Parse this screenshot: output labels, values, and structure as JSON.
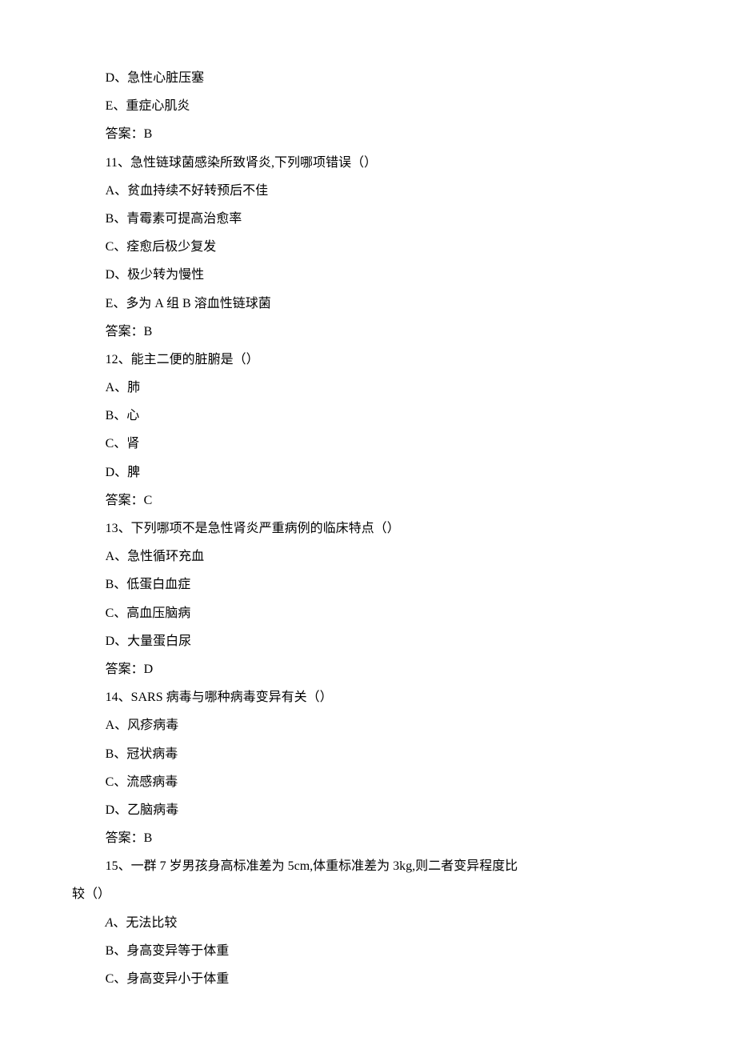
{
  "lines": [
    {
      "text": "D、急性心脏压塞",
      "indent": true
    },
    {
      "text": "E、重症心肌炎",
      "indent": true
    },
    {
      "text": "答案：B",
      "indent": true
    },
    {
      "text": "11、急性链球菌感染所致肾炎,下列哪项错误（）",
      "indent": true
    },
    {
      "text": "A、贫血持续不好转预后不佳",
      "indent": true
    },
    {
      "text": "B、青霉素可提高治愈率",
      "indent": true
    },
    {
      "text": "C、痊愈后极少复发",
      "indent": true
    },
    {
      "text": "D、极少转为慢性",
      "indent": true
    },
    {
      "text": "E、多为 A 组 B 溶血性链球菌",
      "indent": true
    },
    {
      "text": "答案：B",
      "indent": true
    },
    {
      "text": "12、能主二便的脏腑是（）",
      "indent": true
    },
    {
      "text": "A、肺",
      "indent": true
    },
    {
      "text": "B、心",
      "indent": true
    },
    {
      "text": "C、肾",
      "indent": true
    },
    {
      "text": "D、脾",
      "indent": true
    },
    {
      "text": "答案：C",
      "indent": true
    },
    {
      "text": "13、下列哪项不是急性肾炎严重病例的临床特点（）",
      "indent": true
    },
    {
      "text": "A、急性循环充血",
      "indent": true
    },
    {
      "text": "B、低蛋白血症",
      "indent": true
    },
    {
      "text": "C、高血压脑病",
      "indent": true
    },
    {
      "text": "D、大量蛋白尿",
      "indent": true
    },
    {
      "text": "答案：D",
      "indent": true
    },
    {
      "text": "14、SARS 病毒与哪种病毒变异有关（）",
      "indent": true
    },
    {
      "text": "A、风疹病毒",
      "indent": true
    },
    {
      "text": "B、冠状病毒",
      "indent": true
    },
    {
      "text": "C、流感病毒",
      "indent": true
    },
    {
      "text": "D、乙脑病毒",
      "indent": true
    },
    {
      "text": "答案：B",
      "indent": true
    },
    {
      "text": "15、一群 7 岁男孩身高标准差为 5cm,体重标准差为 3kg,则二者变异程度比",
      "indent": true
    },
    {
      "text": "较（）",
      "indent": false
    },
    {
      "prefix": "A",
      "prefixItalic": true,
      "rest": "、无法比较",
      "indent": true
    },
    {
      "text": "B、身高变异等于体重",
      "indent": true
    },
    {
      "text": "C、身高变异小于体重",
      "indent": true
    }
  ]
}
